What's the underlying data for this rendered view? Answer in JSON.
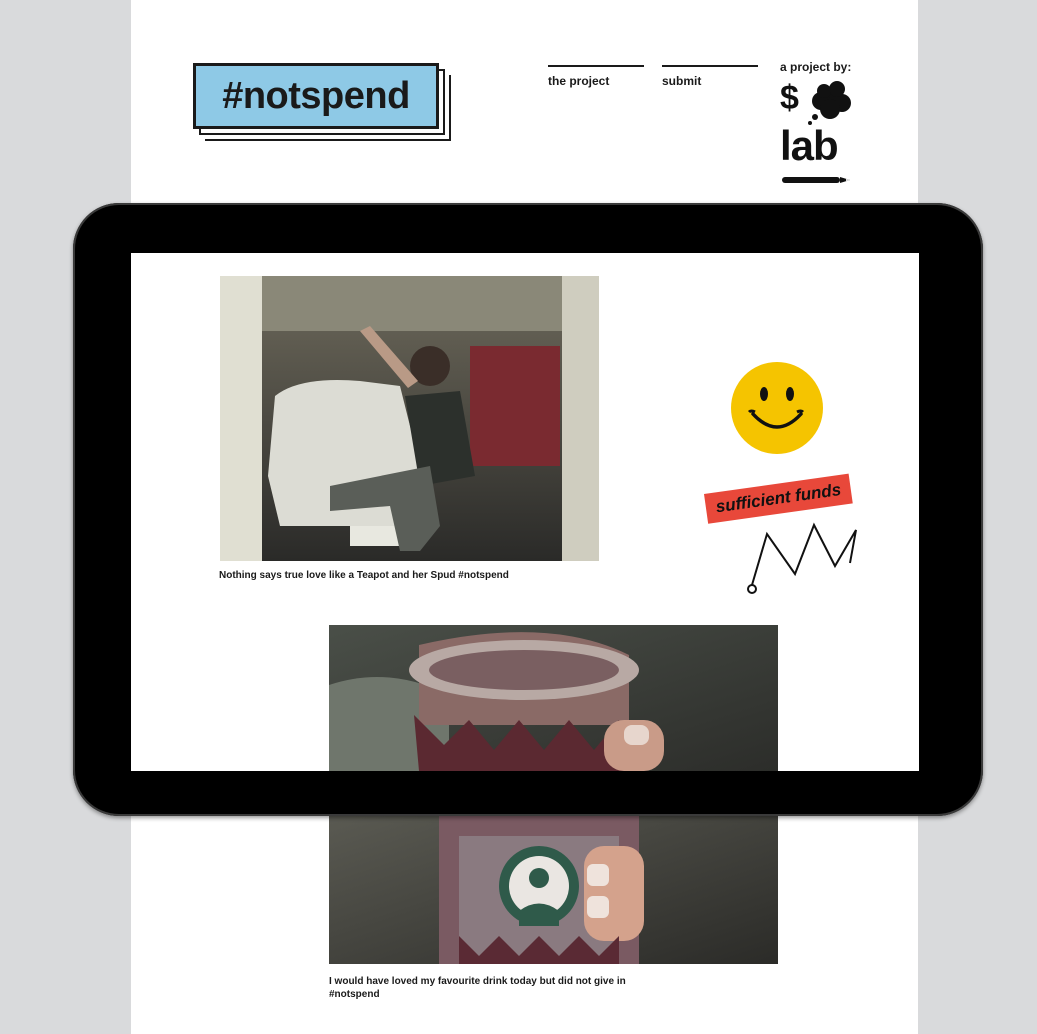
{
  "logo": {
    "text": "#notspend"
  },
  "nav": {
    "items": [
      "the project",
      "submit"
    ]
  },
  "byline": "a project by:",
  "lab_logo": {
    "symbol": "$",
    "text": "lab"
  },
  "posts": [
    {
      "caption": "Nothing says true love like a Teapot and her Spud #notspend"
    },
    {
      "caption": "I would have loved my favourite drink today but did not give in #notspend"
    }
  ],
  "stickers": {
    "smiley": {
      "color": "#f5c400"
    },
    "funds": {
      "text": "sufficient funds",
      "color": "#e8483a"
    }
  },
  "colors": {
    "logo_bg": "#8ec9e6",
    "side_bg": "#d9dadc"
  }
}
